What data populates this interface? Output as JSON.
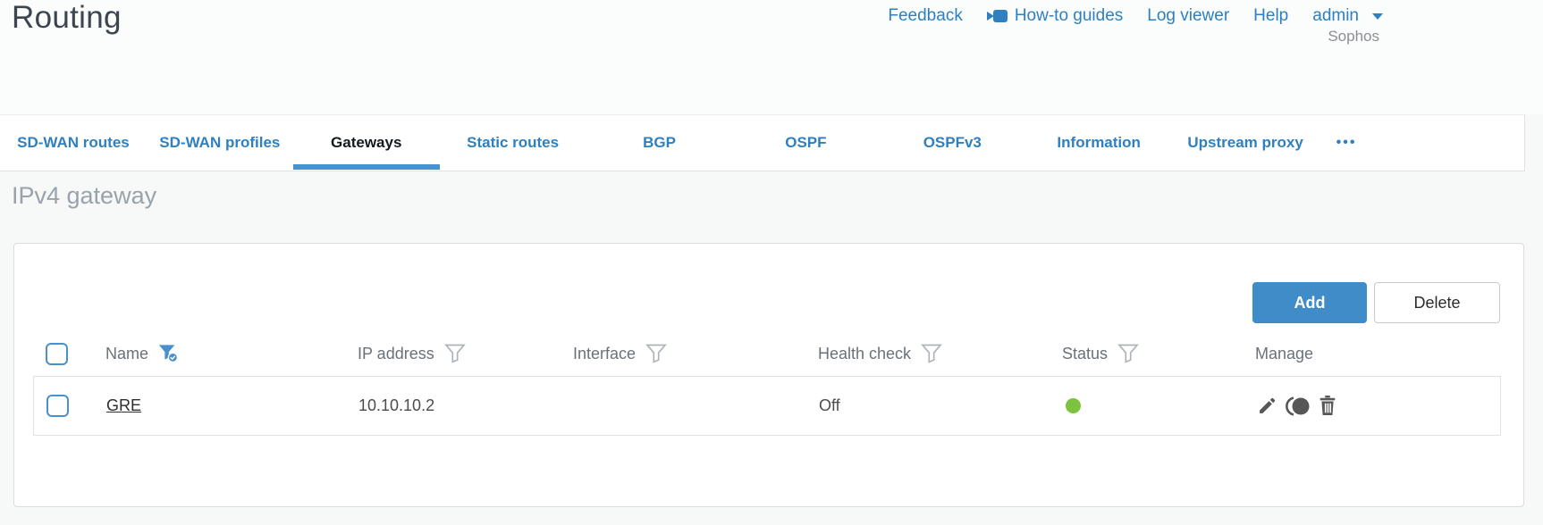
{
  "brand": "Sophos",
  "page_title": "Routing",
  "nav": {
    "feedback": "Feedback",
    "howto_guides": "How-to guides",
    "log_viewer": "Log viewer",
    "help": "Help",
    "user": "admin"
  },
  "tabs": [
    {
      "label": "SD-WAN routes",
      "active": false
    },
    {
      "label": "SD-WAN profiles",
      "active": false
    },
    {
      "label": "Gateways",
      "active": true
    },
    {
      "label": "Static routes",
      "active": false
    },
    {
      "label": "BGP",
      "active": false
    },
    {
      "label": "OSPF",
      "active": false
    },
    {
      "label": "OSPFv3",
      "active": false
    },
    {
      "label": "Information",
      "active": false
    },
    {
      "label": "Upstream proxy",
      "active": false
    }
  ],
  "more_tabs_label": "•••",
  "section_heading": "IPv4 gateway",
  "toolbar": {
    "add_label": "Add",
    "delete_label": "Delete"
  },
  "table": {
    "columns": [
      {
        "label": "Name",
        "filter": "active"
      },
      {
        "label": "IP address",
        "filter": "inactive"
      },
      {
        "label": "Interface",
        "filter": "inactive"
      },
      {
        "label": "Health check",
        "filter": "inactive"
      },
      {
        "label": "Status",
        "filter": "inactive"
      },
      {
        "label": "Manage",
        "filter": "none"
      }
    ],
    "rows": [
      {
        "name": "GRE",
        "ip_address": "10.10.10.2",
        "interface": "",
        "health_check": "Off",
        "status": "up"
      }
    ]
  },
  "colors": {
    "link_blue": "#2e80c0",
    "button_blue": "#3f8cc8",
    "active_tab_underline": "#4a92ce",
    "status_green": "#7cc33f"
  }
}
